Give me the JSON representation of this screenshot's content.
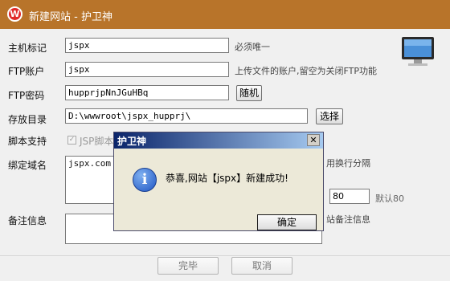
{
  "window": {
    "title": "新建网站 - 护卫神",
    "logo_letter": "W"
  },
  "form": {
    "host": {
      "label": "主机标记",
      "value": "jspx",
      "hint": "必须唯一"
    },
    "ftp_account": {
      "label": "FTP账户",
      "value": "jspx",
      "hint": "上传文件的账户,留空为关闭FTP功能"
    },
    "ftp_password": {
      "label": "FTP密码",
      "value": "hupprjpNnJGuHBq",
      "random_button": "随机"
    },
    "directory": {
      "label": "存放目录",
      "value": "D:\\wwwroot\\jspx_hupprj\\",
      "browse_button": "选择"
    },
    "script_support": {
      "label": "脚本支持",
      "option": "JSP脚本",
      "checked": true
    },
    "domain": {
      "label": "绑定域名",
      "value": "jspx.com",
      "hint_partial": "用换行分隔"
    },
    "port": {
      "value": "80",
      "hint": "默认80"
    },
    "remark": {
      "label": "备注信息",
      "value": "",
      "hint_partial": "站备注信息"
    }
  },
  "footer": {
    "ok_label": "完毕",
    "cancel_label": "取消"
  },
  "dialog": {
    "title": "护卫神",
    "close_glyph": "✕",
    "icon_glyph": "i",
    "message": "恭喜,网站【jspx】新建成功!",
    "ok_label": "确定"
  },
  "colors": {
    "titlebar": "#b8742a",
    "dialog_title_start": "#0a246a",
    "dialog_title_end": "#a6caf0",
    "logo": "#e02828"
  }
}
